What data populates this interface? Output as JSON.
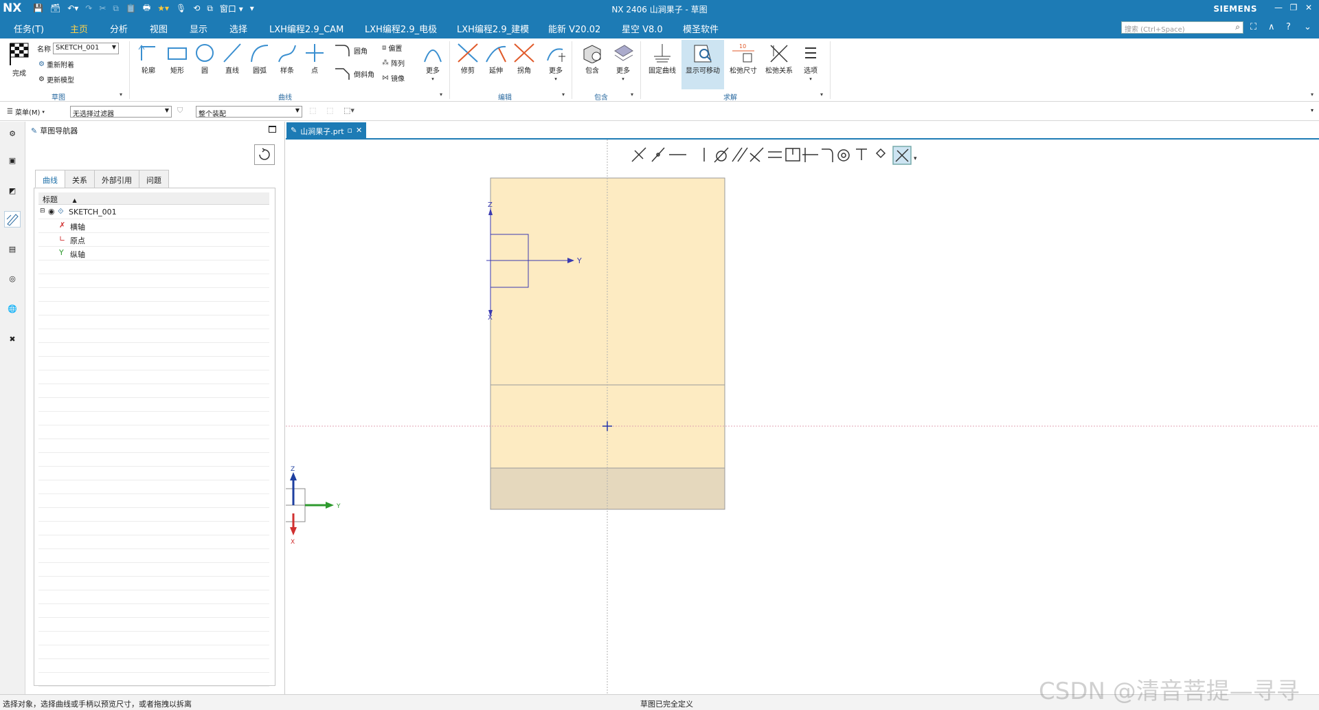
{
  "titlebar": {
    "logo": "NX",
    "window_menu": "窗口",
    "title": "NX 2406 山涧果子 - 草图",
    "brand": "SIEMENS"
  },
  "menubar": {
    "tabs": [
      "任务(T)",
      "主页",
      "分析",
      "视图",
      "显示",
      "选择",
      "LXH编程2.9_CAM",
      "LXH编程2.9_电极",
      "LXH编程2.9_建模",
      "能新 V20.02",
      "星空 V8.0",
      "模圣软件"
    ],
    "active_tab": "主页",
    "search_placeholder": "搜索 (Ctrl+Space)"
  },
  "ribbon": {
    "sketch_group": {
      "finish_label": "完成",
      "name_label": "名称",
      "name_value": "SKETCH_001",
      "reattach_label": "重新附着",
      "update_model_label": "更新模型",
      "group_label": "草图"
    },
    "curve_group": {
      "buttons": [
        "轮廓",
        "矩形",
        "圆",
        "直线",
        "圆弧",
        "样条",
        "点"
      ],
      "fillet_label": "圆角",
      "chamfer_label": "倒斜角",
      "offset_label": "偏置",
      "pattern_label": "阵列",
      "mirror_label": "镜像",
      "more_label": "更多",
      "group_label": "曲线"
    },
    "edit_group": {
      "buttons": [
        "修剪",
        "延伸",
        "拐角",
        "更多"
      ],
      "group_label": "编辑"
    },
    "include_group": {
      "buttons": [
        "包含",
        "更多"
      ],
      "group_label": "包含"
    },
    "solve_group": {
      "buttons": [
        "固定曲线",
        "显示可移动",
        "松弛尺寸",
        "松弛关系",
        "选项"
      ],
      "highlighted": "显示可移动",
      "dim_badge": "10",
      "group_label": "求解"
    }
  },
  "selbar": {
    "menu_label": "菜单(M)",
    "filter_value": "无选择过滤器",
    "scope_value": "整个装配"
  },
  "navigator": {
    "title": "草图导航器",
    "tabs": [
      "曲线",
      "关系",
      "外部引用",
      "问题"
    ],
    "active_tab": "曲线",
    "column_header": "标题",
    "root": "SKETCH_001",
    "children": [
      "横轴",
      "原点",
      "纵轴"
    ]
  },
  "document": {
    "tab_label": "山涧果子.prt"
  },
  "graphics": {
    "axis_labels": {
      "z": "Z",
      "y": "Y",
      "x": "X"
    },
    "triad_labels": {
      "z": "Z",
      "y": "Y",
      "x": "X"
    },
    "colors": {
      "sheet": "#fdebc2",
      "sheet_bottom": "#e5d8bd",
      "sketch_line": "#3a3ab0",
      "triad_z": "#1e3fa0",
      "triad_y": "#2e9a2e",
      "triad_x": "#d03030"
    }
  },
  "status": {
    "left": "选择对象，选择曲线或手柄以预览尺寸，或者拖拽以拆离",
    "middle": "草图已完全定义"
  },
  "watermark": "CSDN @清音菩提—寻寻"
}
